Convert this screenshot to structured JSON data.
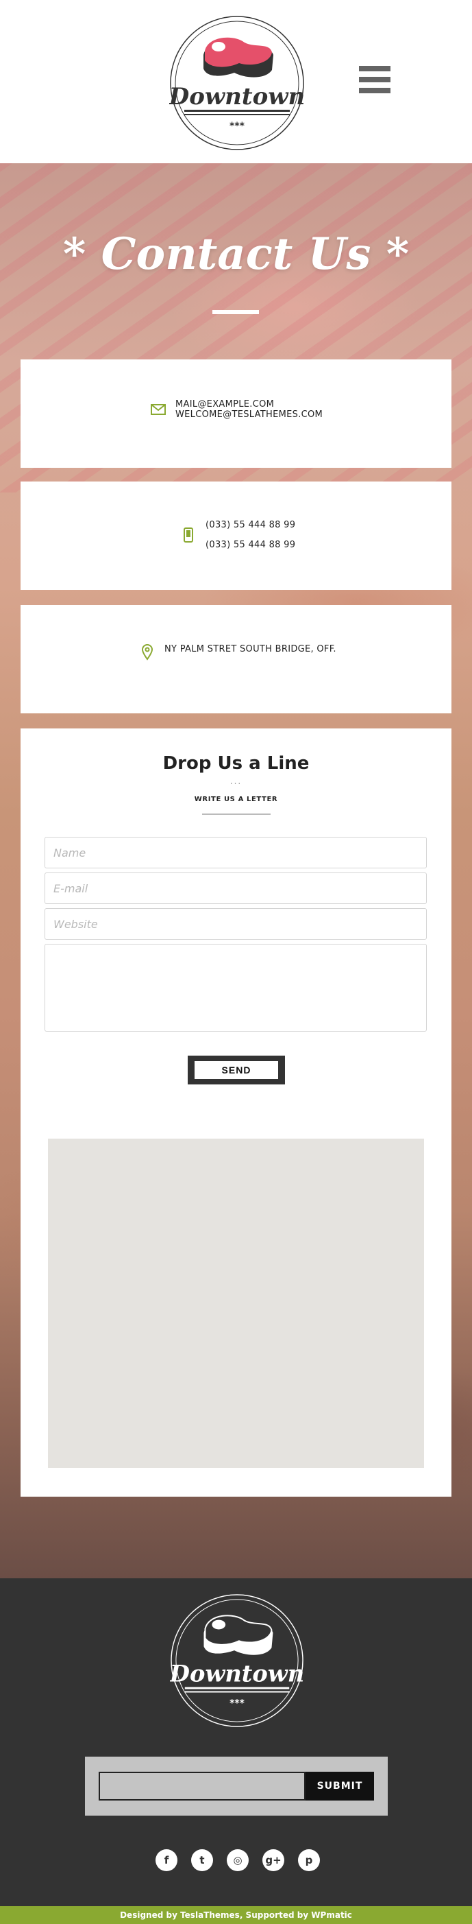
{
  "brand": {
    "name": "Downtown",
    "stars": "***"
  },
  "hero": {
    "title": "* Contact Us *"
  },
  "contact": {
    "emails": [
      "MAIL@EXAMPLE.COM",
      "WELCOME@TESLATHEMES.COM"
    ],
    "phones": [
      "(033) 55 444 88 99",
      "(033) 55 444 88 99"
    ],
    "address": "NY PALM STRET SOUTH BRIDGE, OFF."
  },
  "form": {
    "title": "Drop Us a Line",
    "dots": "...",
    "subtitle": "WRITE US A LETTER",
    "name_placeholder": "Name",
    "email_placeholder": "E-mail",
    "website_placeholder": "Website",
    "message_placeholder": "",
    "send_label": "SEND"
  },
  "footer": {
    "newsletter_button": "SUBMIT",
    "socials": [
      {
        "icon": "facebook-icon",
        "glyph": "f"
      },
      {
        "icon": "twitter-icon",
        "glyph": "t"
      },
      {
        "icon": "dribbble-icon",
        "glyph": "◎"
      },
      {
        "icon": "google-plus-icon",
        "glyph": "g+"
      },
      {
        "icon": "pinterest-icon",
        "glyph": "p"
      }
    ],
    "credits": "Designed by TeslaThemes, Supported by WPmatic"
  },
  "colors": {
    "accent": "#8aa931",
    "steak": "#e5506a",
    "footer_bg": "#333333",
    "map_bg": "#e5e3df"
  }
}
